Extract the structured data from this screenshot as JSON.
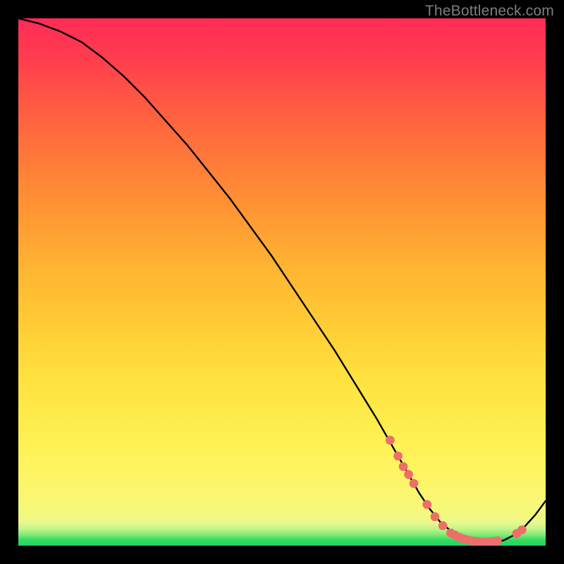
{
  "watermark": "TheBottleneck.com",
  "chart_data": {
    "type": "line",
    "title": "",
    "xlabel": "",
    "ylabel": "",
    "xlim": [
      0,
      100
    ],
    "ylim": [
      0,
      100
    ],
    "grid": false,
    "legend": "none",
    "series": [
      {
        "name": "curve",
        "x": [
          0,
          4,
          8,
          12,
          16,
          20,
          24,
          28,
          32,
          36,
          40,
          44,
          48,
          52,
          56,
          60,
          64,
          68,
          70,
          72,
          74,
          76,
          78,
          80,
          82,
          84,
          86,
          88,
          90,
          92,
          94,
          96,
          98,
          100
        ],
        "y": [
          100,
          99,
          97.5,
          95.5,
          92.5,
          89,
          85,
          80.5,
          76,
          71,
          66,
          60.5,
          55,
          49,
          43,
          37,
          30.5,
          24,
          20.5,
          17,
          13.5,
          10,
          7,
          4.5,
          2.8,
          1.6,
          0.9,
          0.6,
          0.6,
          1.0,
          2.0,
          3.6,
          5.8,
          8.5
        ]
      }
    ],
    "markers": {
      "name": "highlight-points",
      "color": "#ec6f69",
      "points": [
        {
          "x": 70.5,
          "y": 20.0
        },
        {
          "x": 72.0,
          "y": 17.0
        },
        {
          "x": 73.0,
          "y": 15.0
        },
        {
          "x": 74.0,
          "y": 13.5
        },
        {
          "x": 75.0,
          "y": 11.8
        },
        {
          "x": 77.5,
          "y": 7.8
        },
        {
          "x": 79.0,
          "y": 5.5
        },
        {
          "x": 80.5,
          "y": 3.8
        },
        {
          "x": 82.0,
          "y": 2.4
        },
        {
          "x": 82.8,
          "y": 2.0
        },
        {
          "x": 83.6,
          "y": 1.6
        },
        {
          "x": 84.4,
          "y": 1.3
        },
        {
          "x": 85.2,
          "y": 1.1
        },
        {
          "x": 86.0,
          "y": 0.9
        },
        {
          "x": 86.8,
          "y": 0.8
        },
        {
          "x": 87.6,
          "y": 0.7
        },
        {
          "x": 88.4,
          "y": 0.7
        },
        {
          "x": 89.2,
          "y": 0.7
        },
        {
          "x": 90.0,
          "y": 0.8
        },
        {
          "x": 90.8,
          "y": 0.9
        },
        {
          "x": 94.5,
          "y": 2.3
        },
        {
          "x": 95.5,
          "y": 3.0
        }
      ]
    }
  }
}
